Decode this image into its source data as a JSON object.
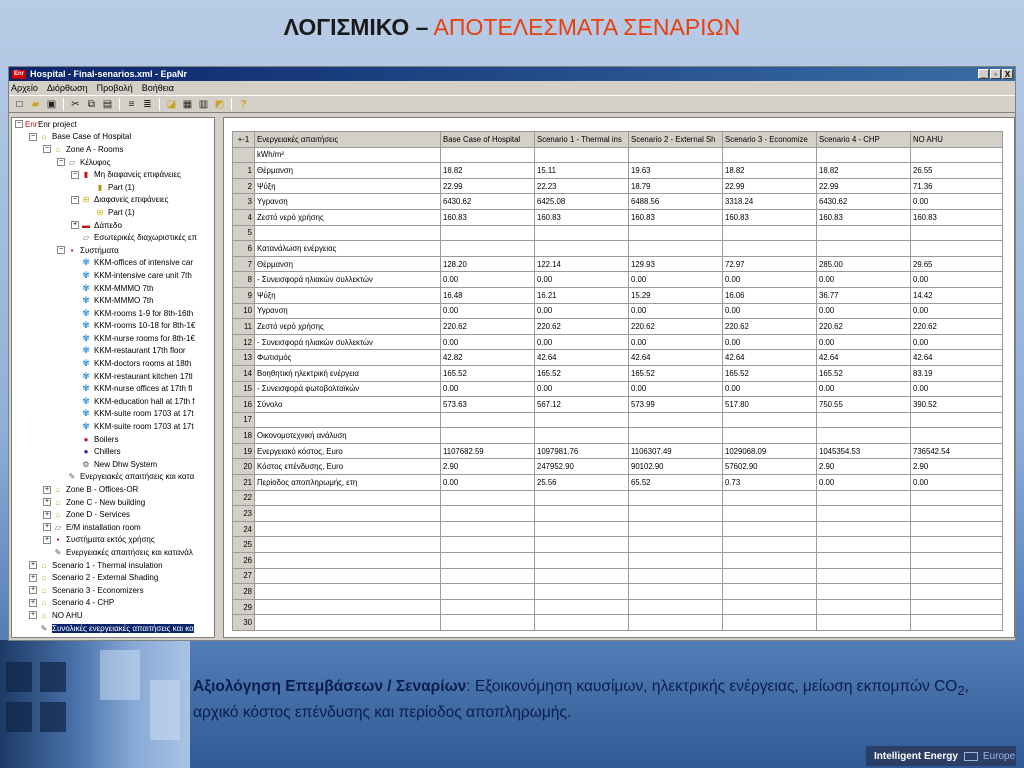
{
  "slide": {
    "title_main": "ΛΟΓΙΣΜΙΚΟ –",
    "title_accent": " ΑΠΟΤΕΛΕΣΜΑΤΑ ΣΕΝΑΡΙΩΝ",
    "caption_bold": "Αξιολόγηση Επεμβάσεων / Σεναρίων",
    "caption_rest": ": Εξοικονόμηση καυσίμων, ηλεκτρικής ενέργειας, μείωση εκπομπών CO",
    "caption_sub": "2",
    "caption_end": ", αρχικό κόστος επένδυσης και περίοδος αποπληρωμής.",
    "footer_brand": "Intelligent Energy",
    "footer_region": "Europe"
  },
  "window": {
    "app_icon": "Enr",
    "title": "Hospital - Final-senarios.xml - EpaNr",
    "controls": [
      "_",
      "▫",
      "X"
    ],
    "menu": [
      "Αρχείο",
      "Διόρθωση",
      "Προβολή",
      "Βοήθεια"
    ]
  },
  "tree": [
    {
      "level": 0,
      "exp": "−",
      "icon": "Enr",
      "iconClass": "ti-red",
      "label": "Enr project"
    },
    {
      "level": 1,
      "exp": "−",
      "icon": "⌂",
      "iconClass": "ti-house",
      "label": "Base Case of Hospital"
    },
    {
      "level": 2,
      "exp": "−",
      "icon": "⌂",
      "iconClass": "ti-house",
      "label": "Zone A - Rooms"
    },
    {
      "level": 3,
      "exp": "−",
      "icon": "▱",
      "iconClass": "ti-doc",
      "label": "Κέλυφος"
    },
    {
      "level": 4,
      "exp": "−",
      "icon": "▮",
      "iconClass": "ti-red",
      "label": "Μη διαφανείς επιφάνειες"
    },
    {
      "level": 5,
      "exp": "",
      "icon": "▮",
      "iconClass": "ti-part",
      "label": "Part (1)"
    },
    {
      "level": 4,
      "exp": "−",
      "icon": "⊞",
      "iconClass": "ti-win",
      "label": "Διαφανείς επιφάνειες"
    },
    {
      "level": 5,
      "exp": "",
      "icon": "⊞",
      "iconClass": "ti-win",
      "label": "Part (1)"
    },
    {
      "level": 4,
      "exp": "+",
      "icon": "▬",
      "iconClass": "ti-red",
      "label": "Δάπεδο"
    },
    {
      "level": 4,
      "exp": "",
      "icon": "▱",
      "iconClass": "ti-doc",
      "label": "Εσωτερικές διαχωριστικές επ"
    },
    {
      "level": 3,
      "exp": "−",
      "icon": "▪",
      "iconClass": "ti-sys",
      "label": "Συστήματα"
    },
    {
      "level": 4,
      "exp": "",
      "icon": "✾",
      "iconClass": "ti-fan",
      "label": "KKM-offices of intensive car"
    },
    {
      "level": 4,
      "exp": "",
      "icon": "✾",
      "iconClass": "ti-fan",
      "label": "KKM-intensive care unit 7th"
    },
    {
      "level": 4,
      "exp": "",
      "icon": "✾",
      "iconClass": "ti-fan",
      "label": "KKM-MMMO 7th"
    },
    {
      "level": 4,
      "exp": "",
      "icon": "✾",
      "iconClass": "ti-fan",
      "label": "KKM-MMMO 7th"
    },
    {
      "level": 4,
      "exp": "",
      "icon": "✾",
      "iconClass": "ti-fan",
      "label": "KKM-rooms 1-9 for 8th-16th"
    },
    {
      "level": 4,
      "exp": "",
      "icon": "✾",
      "iconClass": "ti-fan",
      "label": "KKM-rooms 10-18 for 8th-1€"
    },
    {
      "level": 4,
      "exp": "",
      "icon": "✾",
      "iconClass": "ti-fan",
      "label": "KKM-nurse rooms for 8th-1€"
    },
    {
      "level": 4,
      "exp": "",
      "icon": "✾",
      "iconClass": "ti-fan",
      "label": "KKM-restaurant 17th floor"
    },
    {
      "level": 4,
      "exp": "",
      "icon": "✾",
      "iconClass": "ti-fan",
      "label": "KKM-doctors rooms at 18th"
    },
    {
      "level": 4,
      "exp": "",
      "icon": "✾",
      "iconClass": "ti-fan",
      "label": "KKM-restaurant kitchen 17tl"
    },
    {
      "level": 4,
      "exp": "",
      "icon": "✾",
      "iconClass": "ti-fan",
      "label": "KKM-nurse offices at 17th fl"
    },
    {
      "level": 4,
      "exp": "",
      "icon": "✾",
      "iconClass": "ti-fan",
      "label": "KKM-education hall at 17th f"
    },
    {
      "level": 4,
      "exp": "",
      "icon": "✾",
      "iconClass": "ti-fan",
      "label": "KKM-suite room 1703 at 17t"
    },
    {
      "level": 4,
      "exp": "",
      "icon": "✾",
      "iconClass": "ti-fan",
      "label": "KKM-suite room 1703 at 17t"
    },
    {
      "level": 4,
      "exp": "",
      "icon": "●",
      "iconClass": "ti-red",
      "label": "Boilers"
    },
    {
      "level": 4,
      "exp": "",
      "icon": "●",
      "iconClass": "ti-blue",
      "label": "Chillers"
    },
    {
      "level": 4,
      "exp": "",
      "icon": "⚙",
      "iconClass": "ti-doc",
      "label": "New Dhw System"
    },
    {
      "level": 3,
      "exp": "",
      "icon": "✎",
      "iconClass": "ti-doc",
      "label": "Ενεργειακές απαιτήσεις και κατα"
    },
    {
      "level": 2,
      "exp": "+",
      "icon": "⌂",
      "iconClass": "ti-house",
      "label": "Zone B - Offices-OR"
    },
    {
      "level": 2,
      "exp": "+",
      "icon": "⌂",
      "iconClass": "ti-house",
      "label": "Zone C - New building"
    },
    {
      "level": 2,
      "exp": "+",
      "icon": "⌂",
      "iconClass": "ti-house",
      "label": "Zone D - Services"
    },
    {
      "level": 2,
      "exp": "+",
      "icon": "▱",
      "iconClass": "ti-doc",
      "label": "E/M installation room"
    },
    {
      "level": 2,
      "exp": "+",
      "icon": "▪",
      "iconClass": "ti-sys",
      "label": "Συστήματα εκτός χρήσης"
    },
    {
      "level": 2,
      "exp": "",
      "icon": "✎",
      "iconClass": "ti-doc",
      "label": "Ενεργειακές απαιτήσεις και κατανάλ"
    },
    {
      "level": 1,
      "exp": "+",
      "icon": "⌂",
      "iconClass": "ti-house",
      "label": "Scenario 1 - Thermal insulation"
    },
    {
      "level": 1,
      "exp": "+",
      "icon": "⌂",
      "iconClass": "ti-house",
      "label": "Scenario 2 - External Shading"
    },
    {
      "level": 1,
      "exp": "+",
      "icon": "⌂",
      "iconClass": "ti-house",
      "label": "Scenario 3 - Economizers"
    },
    {
      "level": 1,
      "exp": "+",
      "icon": "⌂",
      "iconClass": "ti-house",
      "label": "Scenario 4 - CHP"
    },
    {
      "level": 1,
      "exp": "+",
      "icon": "⌂",
      "iconClass": "ti-house",
      "label": "NO AHU"
    },
    {
      "level": 1,
      "exp": "",
      "icon": "✎",
      "iconClass": "ti-doc",
      "label": "Συνολικές ενεργειακές απαιτήσεις και κα",
      "selected": true
    }
  ],
  "grid": {
    "corner": "+-1",
    "headers": [
      "Ενεργειακές απαιτήσεις",
      "Base Case of Hospital",
      "Scenario 1 - Thermal ins",
      "Scenario 2 - External Sh",
      "Scenario 3 - Economize",
      "Scenario 4 - CHP",
      "NO AHU"
    ],
    "rows": [
      {
        "no": "",
        "cells": [
          "kWh/m²",
          "",
          "",
          "",
          "",
          "",
          ""
        ]
      },
      {
        "no": "1",
        "cells": [
          "Θέρμανση",
          "18.82",
          "15.11",
          "19.63",
          "18.82",
          "18.82",
          "26.55"
        ]
      },
      {
        "no": "2",
        "cells": [
          "Ψύξη",
          "22.99",
          "22.23",
          "18.79",
          "22.99",
          "22.99",
          "71.36"
        ]
      },
      {
        "no": "3",
        "cells": [
          "Υγρανση",
          "6430.62",
          "6425.08",
          "6488.56",
          "3318.24",
          "6430.62",
          "0.00"
        ]
      },
      {
        "no": "4",
        "cells": [
          "Ζεστό νερό χρήσης",
          "160.83",
          "160.83",
          "160.83",
          "160.83",
          "160.83",
          "160.83"
        ]
      },
      {
        "no": "5",
        "cells": [
          "",
          "",
          "",
          "",
          "",
          "",
          ""
        ]
      },
      {
        "no": "6",
        "cells": [
          "Κατανάλωση ενέργειας",
          "",
          "",
          "",
          "",
          "",
          ""
        ]
      },
      {
        "no": "7",
        "cells": [
          "Θέρμανση",
          "128.20",
          "122.14",
          "129.93",
          "72.97",
          "285.00",
          "29.65"
        ]
      },
      {
        "no": "8",
        "cells": [
          "- Συνεισφορά ηλιακών συλλεκτών",
          "0.00",
          "0.00",
          "0.00",
          "0.00",
          "0.00",
          "0.00"
        ]
      },
      {
        "no": "9",
        "cells": [
          "Ψύξη",
          "16.48",
          "16.21",
          "15.29",
          "16.06",
          "36.77",
          "14.42"
        ]
      },
      {
        "no": "10",
        "cells": [
          "Υγρανση",
          "0.00",
          "0.00",
          "0.00",
          "0.00",
          "0.00",
          "0.00"
        ]
      },
      {
        "no": "11",
        "cells": [
          "Ζεστό νερό χρήσης",
          "220.62",
          "220.62",
          "220.62",
          "220.62",
          "220.62",
          "220.62"
        ]
      },
      {
        "no": "12",
        "cells": [
          "- Συνεισφορά ηλιακών συλλεκτών",
          "0.00",
          "0.00",
          "0.00",
          "0.00",
          "0.00",
          "0.00"
        ]
      },
      {
        "no": "13",
        "cells": [
          "Φωτισμός",
          "42.82",
          "42.64",
          "42.64",
          "42.64",
          "42.64",
          "42.64"
        ]
      },
      {
        "no": "14",
        "cells": [
          "Βοηθητική ηλεκτρική ενέργεια",
          "165.52",
          "165.52",
          "165.52",
          "165.52",
          "165.52",
          "83.19"
        ]
      },
      {
        "no": "15",
        "cells": [
          "- Συνεισφορά φωτοβολταϊκών",
          "0.00",
          "0.00",
          "0.00",
          "0.00",
          "0.00",
          "0.00"
        ]
      },
      {
        "no": "16",
        "cells": [
          "Σύνολο",
          "573.63",
          "567.12",
          "573.99",
          "517.80",
          "750.55",
          "390.52"
        ]
      },
      {
        "no": "17",
        "cells": [
          "",
          "",
          "",
          "",
          "",
          "",
          ""
        ]
      },
      {
        "no": "18",
        "cells": [
          "Οικονομοτεχνική ανάλυση",
          "",
          "",
          "",
          "",
          "",
          ""
        ]
      },
      {
        "no": "19",
        "cells": [
          "Ενεργειακό κόστος, Euro",
          "1107682.59",
          "1097981.76",
          "1106307.49",
          "1029068.09",
          "1045354.53",
          "736542.54"
        ]
      },
      {
        "no": "20",
        "cells": [
          "Κόστος επένδυσης, Euro",
          "2.90",
          "247952.90",
          "90102.90",
          "57602.90",
          "2.90",
          "2.90"
        ]
      },
      {
        "no": "21",
        "cells": [
          "Περίοδος αποπληρωμής, ετη",
          "0.00",
          "25.56",
          "65.52",
          "0.73",
          "0.00",
          "0.00"
        ]
      },
      {
        "no": "22",
        "cells": [
          "",
          "",
          "",
          "",
          "",
          "",
          ""
        ]
      },
      {
        "no": "23",
        "cells": [
          "",
          "",
          "",
          "",
          "",
          "",
          ""
        ]
      },
      {
        "no": "24",
        "cells": [
          "",
          "",
          "",
          "",
          "",
          "",
          ""
        ]
      },
      {
        "no": "25",
        "cells": [
          "",
          "",
          "",
          "",
          "",
          "",
          ""
        ]
      },
      {
        "no": "26",
        "cells": [
          "",
          "",
          "",
          "",
          "",
          "",
          ""
        ]
      },
      {
        "no": "27",
        "cells": [
          "",
          "",
          "",
          "",
          "",
          "",
          ""
        ]
      },
      {
        "no": "28",
        "cells": [
          "",
          "",
          "",
          "",
          "",
          "",
          ""
        ]
      },
      {
        "no": "29",
        "cells": [
          "",
          "",
          "",
          "",
          "",
          "",
          ""
        ]
      },
      {
        "no": "30",
        "cells": [
          "",
          "",
          "",
          "",
          "",
          "",
          ""
        ]
      }
    ]
  }
}
